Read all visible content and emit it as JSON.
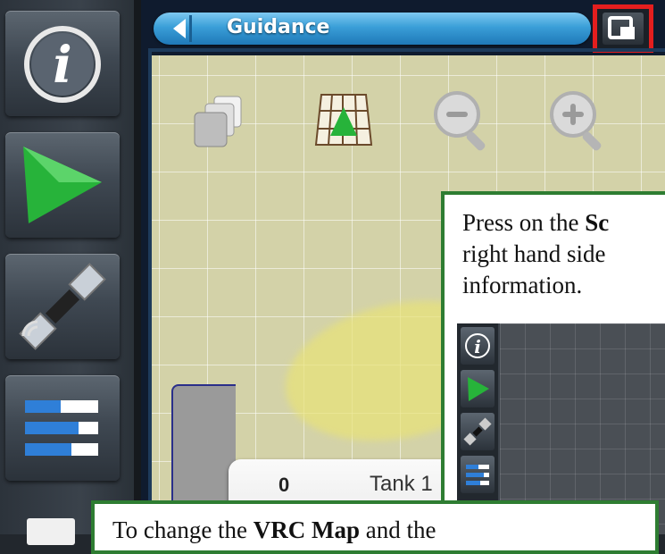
{
  "sidebar": {
    "items": [
      {
        "icon": "info-icon",
        "name": "info"
      },
      {
        "icon": "guidance-triangle-icon",
        "name": "guidance"
      },
      {
        "icon": "satellite-icon",
        "name": "gps"
      },
      {
        "icon": "bars-icon",
        "name": "status"
      }
    ]
  },
  "header": {
    "title": "Guidance",
    "back_icon": "chevron-left-icon",
    "fullscreen_icon": "fullscreen-toggle-icon"
  },
  "toolbar": {
    "tools": [
      "layers-icon",
      "grid-view-icon",
      "zoom-out-icon",
      "zoom-in-icon"
    ]
  },
  "tank": {
    "value": "0",
    "name": "Tank 1"
  },
  "callout_top": {
    "line1_prefix": "Press on the ",
    "line1_bold": "Sc",
    "line2": "right hand side",
    "line3": "information."
  },
  "callout_bottom": {
    "prefix": "To change the ",
    "bold": "VRC Map",
    "suffix": " and the"
  },
  "colors": {
    "title_bar": "#3a9fd8",
    "map_background": "#d3d2a8",
    "highlight_box": "#e41e1e",
    "callout_border": "#2e7d32",
    "guidance_green": "#27b33a"
  }
}
